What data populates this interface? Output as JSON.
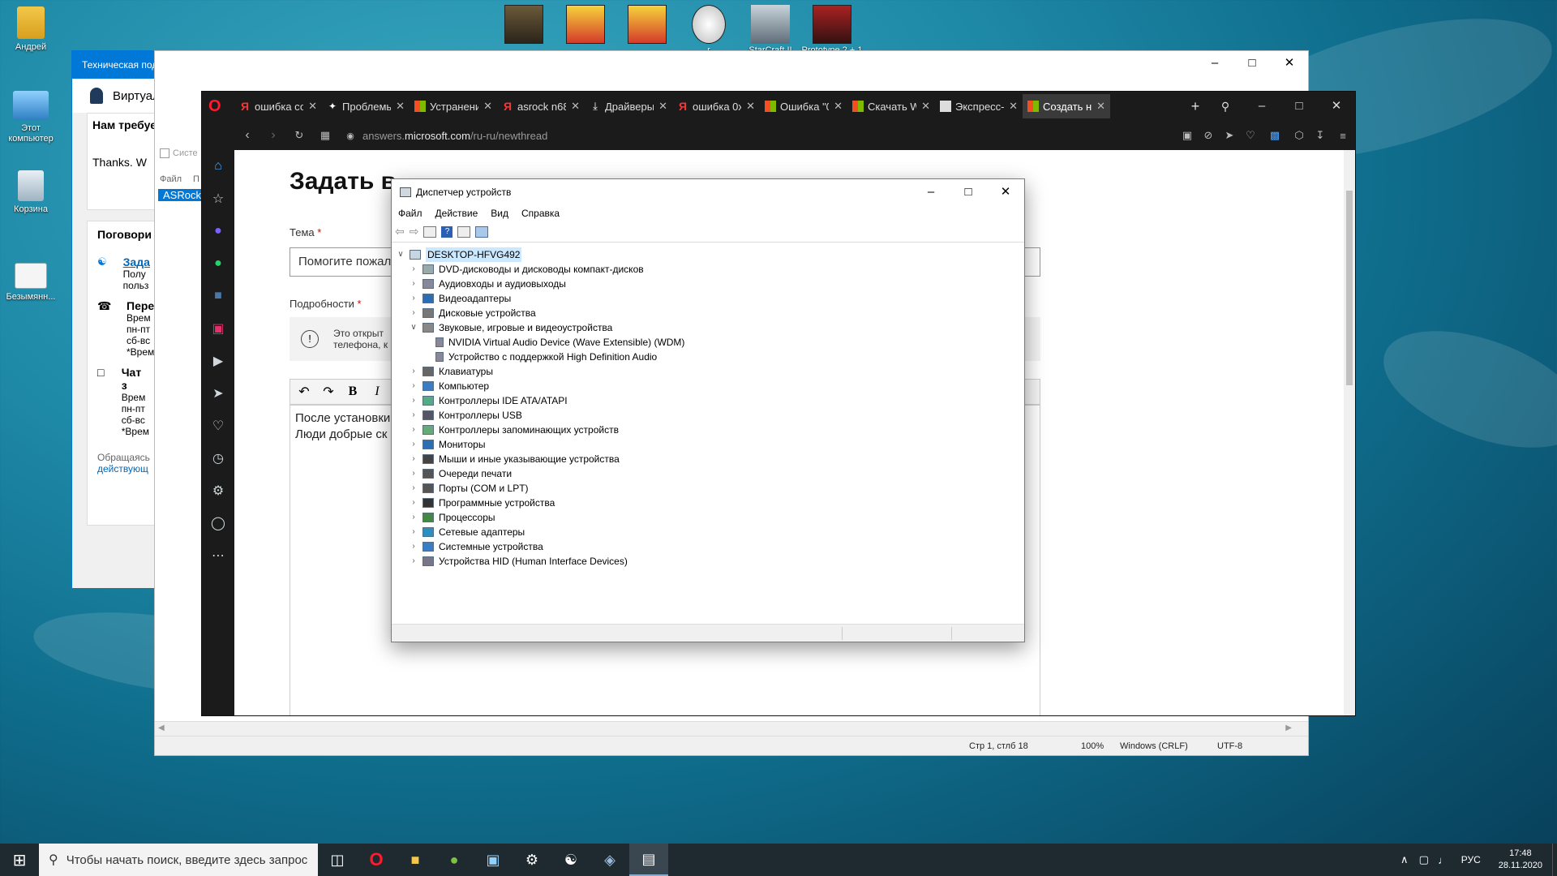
{
  "desktop": {
    "icons": [
      {
        "label": "Андрей"
      },
      {
        "label": "Этот компьютер"
      },
      {
        "label": "Корзина"
      },
      {
        "label": "Безымянн..."
      }
    ],
    "game_icons": [
      {
        "label": ""
      },
      {
        "label": ""
      },
      {
        "label": ""
      },
      {
        "label": "r"
      },
      {
        "label": "StarCraft II"
      },
      {
        "label": "Prototype 2 + 1 DLC"
      }
    ]
  },
  "support_window": {
    "title": "Техническая поддержка",
    "agent_label": "Виртуальный а",
    "need_text": "Нам требуется ещ",
    "thanks_text": "Thanks. W",
    "talk_heading": "Поговори",
    "items": [
      {
        "title": "Зада",
        "lines": [
          "Полу",
          "польз"
        ]
      },
      {
        "title": "Пере",
        "lines": [
          "Врем",
          "пн-пт",
          "сб-вс",
          "*Врем"
        ]
      },
      {
        "title": "Чат з",
        "lines": [
          "Врем",
          "пн-пт",
          "сб-вс",
          "*Врем"
        ]
      }
    ],
    "footer_1": "Обращаясь",
    "footer_2": "действующ"
  },
  "notepad": {
    "title_fragment": "Систе",
    "menu_file": "Файл",
    "menu_p": "П",
    "selected_text": "ASRock",
    "status": {
      "position": "Стр 1, стлб 18",
      "zoom": "100%",
      "eol": "Windows (CRLF)",
      "encoding": "UTF-8"
    }
  },
  "browser": {
    "tabs": [
      {
        "label": "ошибка со",
        "fav": "yandex"
      },
      {
        "label": "Проблемы",
        "fav": "star"
      },
      {
        "label": "Устранение",
        "fav": "ms"
      },
      {
        "label": "asrock n68",
        "fav": "yandex"
      },
      {
        "label": "Драйверы",
        "fav": "download"
      },
      {
        "label": "ошибка 0x",
        "fav": "yandex"
      },
      {
        "label": "Ошибка \"0",
        "fav": "ms"
      },
      {
        "label": "Скачать W",
        "fav": "ms"
      },
      {
        "label": "Экспресс-п",
        "fav": "grid"
      },
      {
        "label": "Создать но",
        "fav": "ms",
        "active": true
      }
    ],
    "url_prefix": "answers.",
    "url_domain": "microsoft.com",
    "url_path": "/ru-ru/newthread",
    "page": {
      "heading": "Задать в",
      "subject_label": "Тема",
      "subject_value": "Помогите пожал",
      "details_label": "Подробности",
      "notice": "Это открыт\nтелефона, к",
      "editor_text_1": "После установки",
      "editor_text_2": "Люди добрые ск"
    }
  },
  "device_manager": {
    "title": "Диспетчер устройств",
    "menu": [
      "Файл",
      "Действие",
      "Вид",
      "Справка"
    ],
    "root": "DESKTOP-HFVG492",
    "nodes": [
      {
        "label": "DVD-дисководы и дисководы компакт-дисков",
        "expanded": false
      },
      {
        "label": "Аудиовходы и аудиовыходы",
        "expanded": false
      },
      {
        "label": "Видеоадаптеры",
        "expanded": false
      },
      {
        "label": "Дисковые устройства",
        "expanded": false
      },
      {
        "label": "Звуковые, игровые и видеоустройства",
        "expanded": true,
        "children": [
          "NVIDIA Virtual Audio Device (Wave Extensible) (WDM)",
          "Устройство с поддержкой High Definition Audio"
        ]
      },
      {
        "label": "Клавиатуры",
        "expanded": false
      },
      {
        "label": "Компьютер",
        "expanded": false
      },
      {
        "label": "Контроллеры IDE ATA/ATAPI",
        "expanded": false
      },
      {
        "label": "Контроллеры USB",
        "expanded": false
      },
      {
        "label": "Контроллеры запоминающих устройств",
        "expanded": false
      },
      {
        "label": "Мониторы",
        "expanded": false
      },
      {
        "label": "Мыши и иные указывающие устройства",
        "expanded": false
      },
      {
        "label": "Очереди печати",
        "expanded": false
      },
      {
        "label": "Порты (COM и LPT)",
        "expanded": false
      },
      {
        "label": "Программные устройства",
        "expanded": false
      },
      {
        "label": "Процессоры",
        "expanded": false
      },
      {
        "label": "Сетевые адаптеры",
        "expanded": false
      },
      {
        "label": "Системные устройства",
        "expanded": false
      },
      {
        "label": "Устройства HID (Human Interface Devices)",
        "expanded": false
      }
    ]
  },
  "taskbar": {
    "search_placeholder": "Чтобы начать поиск, введите здесь запрос",
    "lang": "РУС",
    "time": "17:48",
    "date": "28.11.2020"
  },
  "colors": {
    "accent_blue": "#0078d7",
    "browser_dark": "#1b1b1b",
    "opera_red": "#ff1b2d"
  }
}
